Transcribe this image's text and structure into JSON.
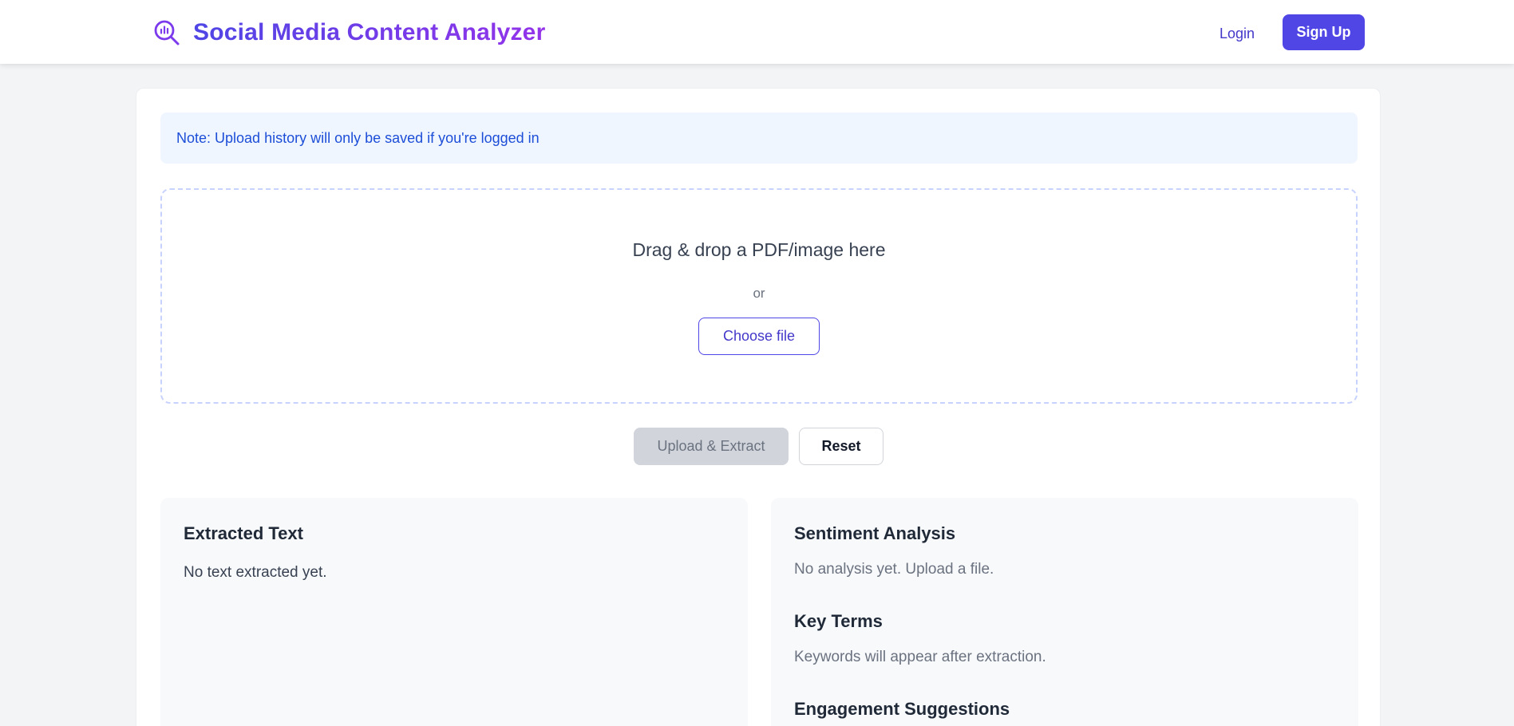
{
  "header": {
    "title": "Social Media Content Analyzer",
    "icon": "search-chart-icon",
    "login_label": "Login",
    "signup_label": "Sign Up"
  },
  "note": {
    "text": "Note: Upload history will only be saved if you're logged in"
  },
  "dropzone": {
    "title": "Drag & drop a PDF/image here",
    "or_text": "or",
    "choose_label": "Choose file"
  },
  "actions": {
    "upload_label": "Upload & Extract",
    "reset_label": "Reset"
  },
  "extracted": {
    "heading": "Extracted Text",
    "placeholder": "No text extracted yet."
  },
  "analysis": {
    "sentiment_heading": "Sentiment Analysis",
    "sentiment_text": "No analysis yet. Upload a file.",
    "keyterms_heading": "Key Terms",
    "keyterms_text": "Keywords will appear after extraction.",
    "engagement_heading": "Engagement Suggestions"
  },
  "colors": {
    "brand_start": "#4f46e5",
    "brand_end": "#9333ea",
    "primary": "#4f46e5",
    "note_bg": "#eff6ff",
    "note_text": "#1d4ed8",
    "disabled_bg": "#d1d5db"
  }
}
